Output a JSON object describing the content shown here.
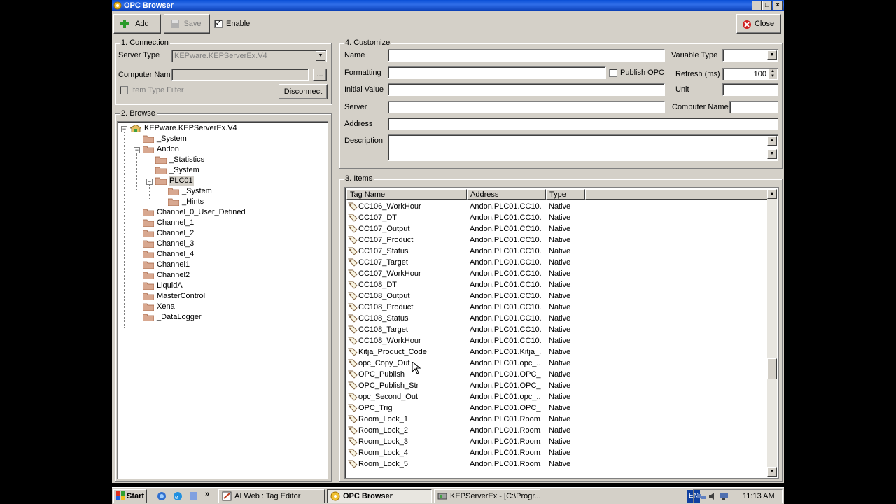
{
  "window": {
    "title": "OPC Browser"
  },
  "toolbar": {
    "add_label": "Add",
    "save_label": "Save",
    "enable_label": "Enable",
    "enable_checked": true,
    "close_label": "Close"
  },
  "connection": {
    "title": "1. Connection",
    "server_type_label": "Server Type",
    "server_type_value": "KEPware.KEPServerEx.V4",
    "computer_name_label": "Computer Name",
    "computer_name_value": "",
    "browse_label": "...",
    "item_type_filter_label": "Item Type Filter",
    "disconnect_label": "Disconnect"
  },
  "browse": {
    "title": "2. Browse",
    "root": "KEPware.KEPServerEx.V4",
    "nodes": [
      "_System",
      "Andon",
      "_Statistics",
      "_System",
      "PLC01",
      "_System",
      "_Hints",
      "Channel_0_User_Defined",
      "Channel_1",
      "Channel_2",
      "Channel_3",
      "Channel_4",
      "Channel1",
      "Channel2",
      "LiquidA",
      "MasterControl",
      "Xena",
      "_DataLogger"
    ]
  },
  "customize": {
    "title": "4. Customize",
    "name_label": "Name",
    "formatting_label": "Formatting",
    "publish_opc_label": "Publish OPC",
    "initial_value_label": "Initial Value",
    "server_label": "Server",
    "address_label": "Address",
    "description_label": "Description",
    "variable_type_label": "Variable Type",
    "refresh_label": "Refresh (ms)",
    "refresh_value": "100",
    "unit_label": "Unit",
    "computer_name_label": "Computer Name"
  },
  "items": {
    "title": "3. Items",
    "columns": [
      "Tag Name",
      "Address",
      "Type"
    ],
    "rows": [
      [
        "CC106_WorkHour",
        "Andon.PLC01.CC10...",
        "Native"
      ],
      [
        "CC107_DT",
        "Andon.PLC01.CC10...",
        "Native"
      ],
      [
        "CC107_Output",
        "Andon.PLC01.CC10...",
        "Native"
      ],
      [
        "CC107_Product",
        "Andon.PLC01.CC10...",
        "Native"
      ],
      [
        "CC107_Status",
        "Andon.PLC01.CC10...",
        "Native"
      ],
      [
        "CC107_Target",
        "Andon.PLC01.CC10...",
        "Native"
      ],
      [
        "CC107_WorkHour",
        "Andon.PLC01.CC10...",
        "Native"
      ],
      [
        "CC108_DT",
        "Andon.PLC01.CC10...",
        "Native"
      ],
      [
        "CC108_Output",
        "Andon.PLC01.CC10...",
        "Native"
      ],
      [
        "CC108_Product",
        "Andon.PLC01.CC10...",
        "Native"
      ],
      [
        "CC108_Status",
        "Andon.PLC01.CC10...",
        "Native"
      ],
      [
        "CC108_Target",
        "Andon.PLC01.CC10...",
        "Native"
      ],
      [
        "CC108_WorkHour",
        "Andon.PLC01.CC10...",
        "Native"
      ],
      [
        "Kitja_Product_Code",
        "Andon.PLC01.Kitja_...",
        "Native"
      ],
      [
        "opc_Copy_Out",
        "Andon.PLC01.opc_...",
        "Native"
      ],
      [
        "OPC_Publish",
        "Andon.PLC01.OPC_...",
        "Native"
      ],
      [
        "OPC_Publish_Str",
        "Andon.PLC01.OPC_...",
        "Native"
      ],
      [
        "opc_Second_Out",
        "Andon.PLC01.opc_...",
        "Native"
      ],
      [
        "OPC_Trig",
        "Andon.PLC01.OPC_...",
        "Native"
      ],
      [
        "Room_Lock_1",
        "Andon.PLC01.Room...",
        "Native"
      ],
      [
        "Room_Lock_2",
        "Andon.PLC01.Room...",
        "Native"
      ],
      [
        "Room_Lock_3",
        "Andon.PLC01.Room...",
        "Native"
      ],
      [
        "Room_Lock_4",
        "Andon.PLC01.Room...",
        "Native"
      ],
      [
        "Room_Lock_5",
        "Andon.PLC01.Room...",
        "Native"
      ]
    ]
  },
  "taskbar": {
    "start_label": "Start",
    "chevron": "»",
    "items": [
      "AI Web : Tag Editor",
      "OPC Browser",
      "KEPServerEx - [C:\\Progr..."
    ],
    "language": "EN",
    "clock": "11:13 AM"
  },
  "icons": [
    "opc-browser-icon",
    "add-icon",
    "save-icon",
    "close-icon",
    "folder-icon",
    "server-icon",
    "tag-icon",
    "windows-logo-icon",
    "ie-icon",
    "desktop-icon"
  ]
}
